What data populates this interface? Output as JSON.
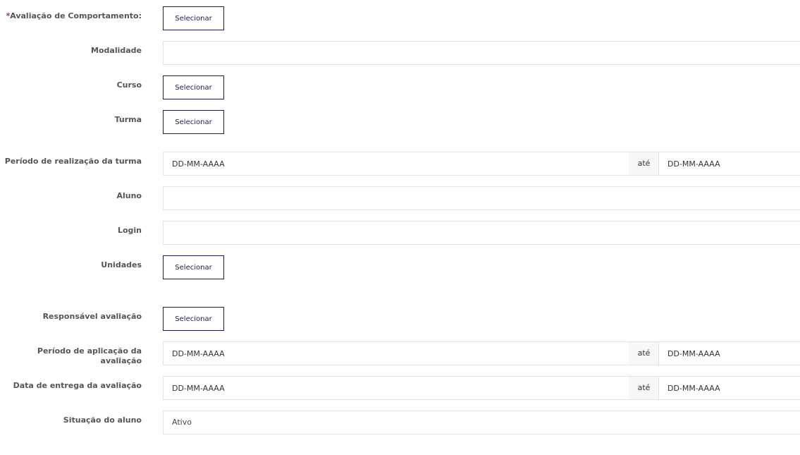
{
  "form": {
    "avaliacao_comportamento": {
      "required_mark": "*",
      "label": "Avaliação de Comportamento:",
      "button_label": "Selecionar"
    },
    "modalidade": {
      "label": "Modalidade",
      "value": ""
    },
    "curso": {
      "label": "Curso",
      "button_label": "Selecionar"
    },
    "turma": {
      "label": "Turma",
      "button_label": "Selecionar"
    },
    "periodo_realizacao_turma": {
      "label": "Período de realização da turma",
      "from_placeholder": "DD-MM-AAAA",
      "separator": "até",
      "to_placeholder": "DD-MM-AAAA"
    },
    "aluno": {
      "label": "Aluno",
      "value": ""
    },
    "login": {
      "label": "Login",
      "value": ""
    },
    "unidades": {
      "label": "Unidades",
      "button_label": "Selecionar"
    },
    "responsavel_avaliacao": {
      "label": "Responsável avaliação",
      "button_label": "Selecionar"
    },
    "periodo_aplicacao_avaliacao": {
      "label": "Período de aplicação da avaliação",
      "from_placeholder": "DD-MM-AAAA",
      "separator": "até",
      "to_placeholder": "DD-MM-AAAA"
    },
    "data_entrega_avaliacao": {
      "label": "Data de entrega da avaliação",
      "from_placeholder": "DD-MM-AAAA",
      "separator": "até",
      "to_placeholder": "DD-MM-AAAA"
    },
    "situacao_aluno": {
      "label": "Situação do aluno",
      "selected": "Ativo"
    }
  },
  "colors": {
    "button_border": "#2b1450",
    "required": "#cc2222",
    "label": "#555555",
    "input_border": "#e2e2e2"
  }
}
